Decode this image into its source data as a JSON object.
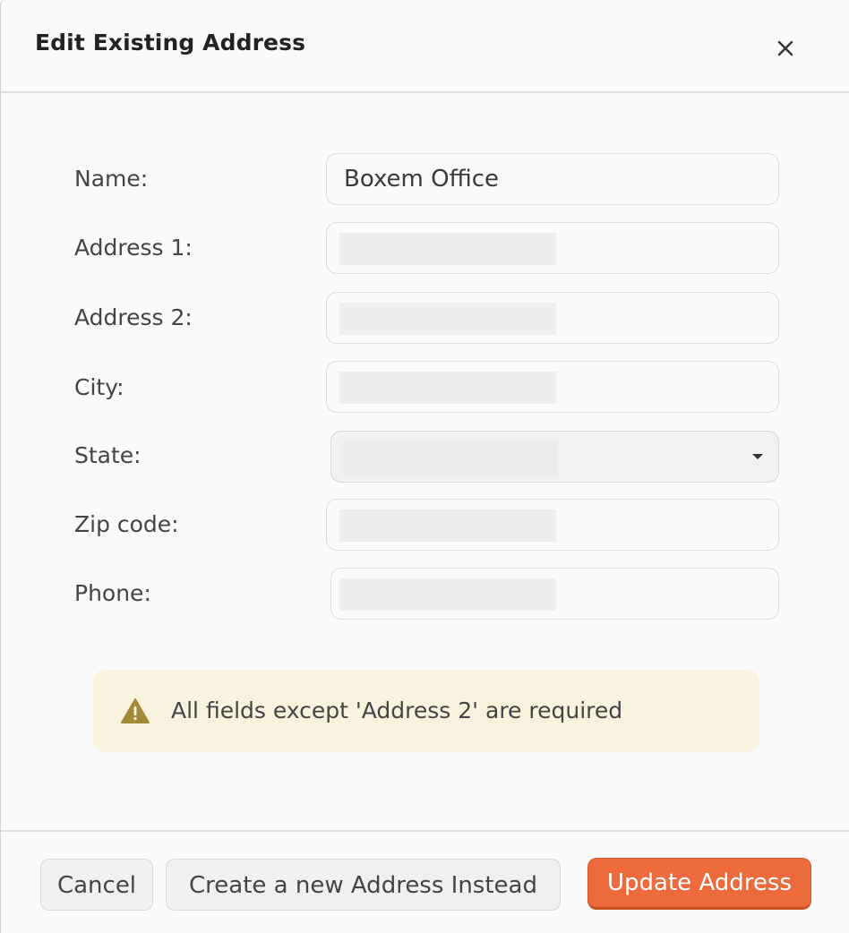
{
  "dialog": {
    "title": "Edit Existing Address"
  },
  "form": {
    "name": {
      "label": "Name:",
      "value": "Boxem Office"
    },
    "address1": {
      "label": "Address 1:"
    },
    "address2": {
      "label": "Address 2:"
    },
    "city": {
      "label": "City:"
    },
    "state": {
      "label": "State:"
    },
    "zip": {
      "label": "Zip code:"
    },
    "phone": {
      "label": "Phone:"
    }
  },
  "notice": {
    "text": "All fields except 'Address 2' are required",
    "icon": "warning-icon",
    "icon_color": "#a28a38",
    "background": "#f8f2df"
  },
  "footer": {
    "cancel_label": "Cancel",
    "create_label": "Create a new Address Instead",
    "update_label": "Update Address",
    "accent": "#ec6a3c"
  }
}
